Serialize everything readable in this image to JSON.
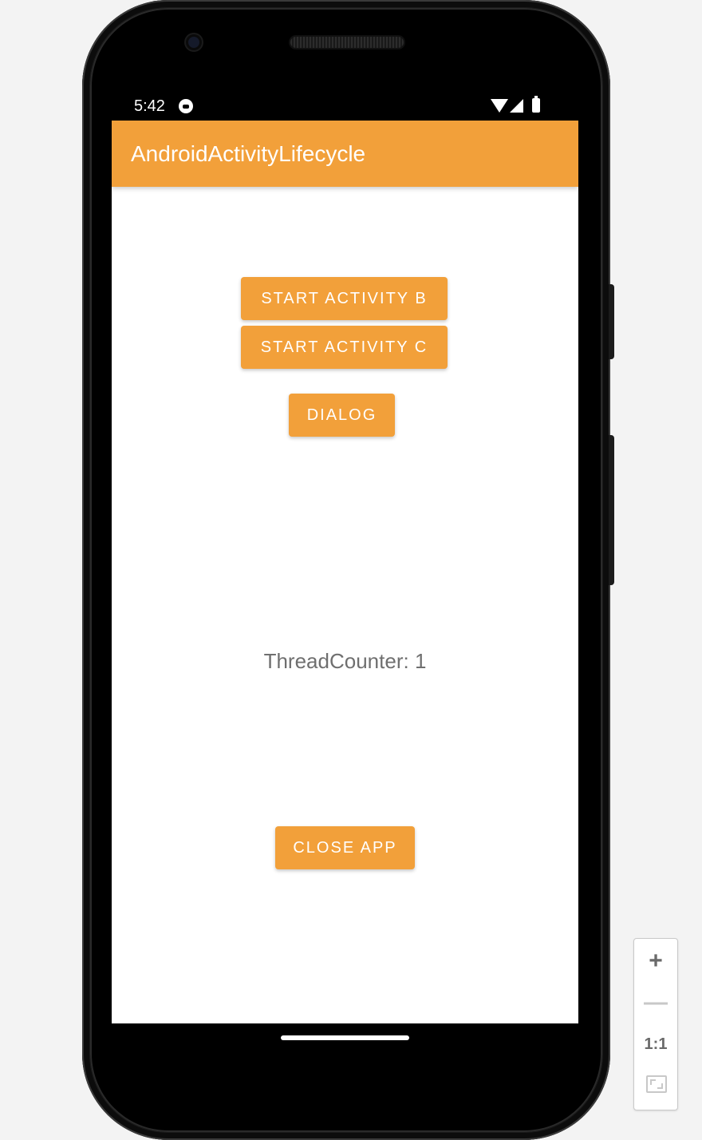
{
  "status_bar": {
    "time": "5:42",
    "icons": [
      "app-notification-icon",
      "wifi-icon",
      "signal-icon",
      "battery-icon"
    ]
  },
  "app_bar": {
    "title": "AndroidActivityLifecycle",
    "color": "#f2a03a"
  },
  "buttons": {
    "start_activity_b": "START ACTIVITY B",
    "start_activity_c": "START ACTIVITY C",
    "dialog": "DIALOG",
    "close_app": "CLOSE APP"
  },
  "thread_counter": {
    "label": "ThreadCounter:",
    "value": "1"
  },
  "zoom_controls": {
    "zoom_in": "+",
    "zoom_out": "—",
    "actual_size": "1:1",
    "icons": [
      "plus-icon",
      "minus-icon",
      "one-to-one-icon",
      "fit-screen-icon"
    ]
  }
}
